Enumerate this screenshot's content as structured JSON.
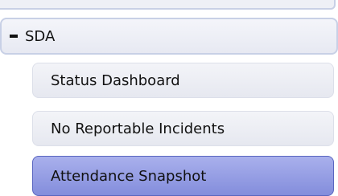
{
  "nav": {
    "group": {
      "label": "SDA",
      "state_icon": "minus-icon"
    },
    "items": [
      {
        "label": "Status Dashboard",
        "selected": false
      },
      {
        "label": "No Reportable Incidents",
        "selected": false
      },
      {
        "label": "Attendance Snapshot",
        "selected": true
      }
    ],
    "colors": {
      "selected_bg": "#9aa2e6",
      "item_bg": "#eceef4",
      "border": "#c8d0e6"
    }
  }
}
